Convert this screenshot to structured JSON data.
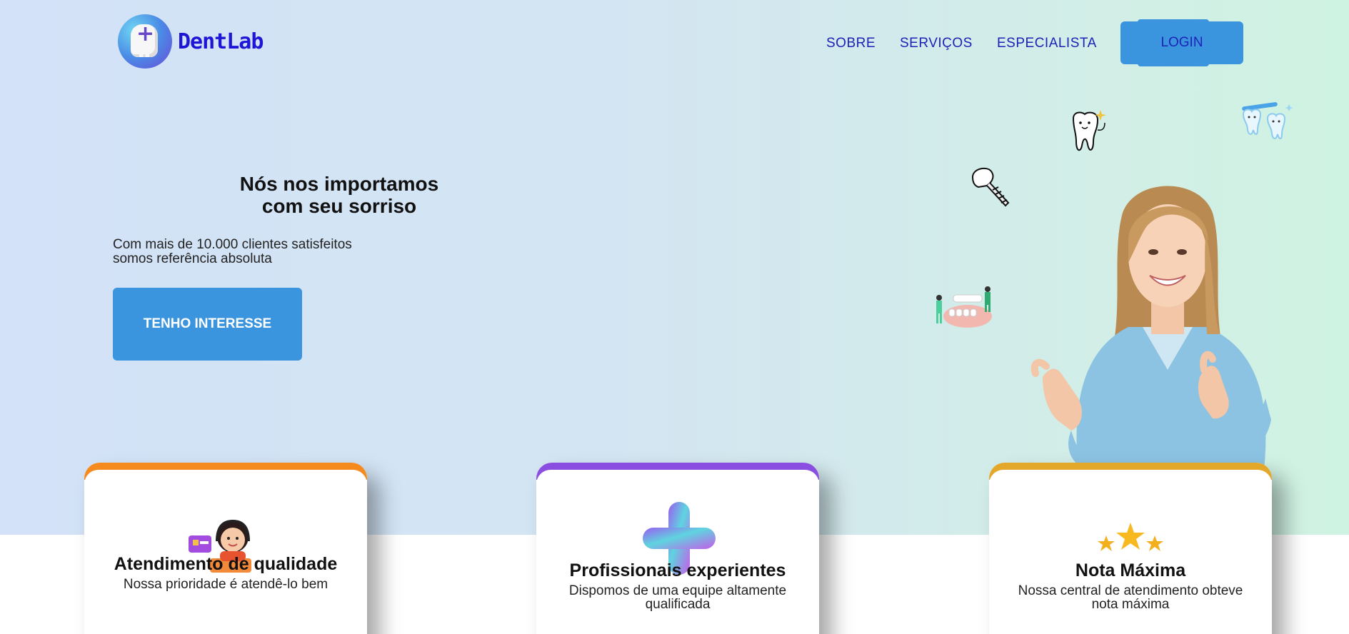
{
  "header": {
    "logo_text": "DentLab",
    "nav": [
      "SOBRE",
      "SERVIÇOS",
      "ESPECIALISTA"
    ],
    "login_label": "LOGIN"
  },
  "hero": {
    "title_line1": "Nós nos importamos",
    "title_line2": "com seu sorriso",
    "subtitle_line1": "Com mais de 10.000 clientes satisfeitos",
    "subtitle_line2": "somos referência absoluta",
    "cta_label": "TENHO INTERESSE"
  },
  "cards": [
    {
      "title": "Atendimento de qualidade",
      "description": "Nossa prioridade é atendê-lo bem",
      "accent": "#f58a1f",
      "icon": "support-agent-icon"
    },
    {
      "title": "Profissionais experientes",
      "description": "Dispomos de uma equipe altamente qualificada",
      "accent": "#8a4fe0",
      "icon": "plus-icon"
    },
    {
      "title": "Nota Máxima",
      "description": "Nossa central de atendimento obteve nota máxima",
      "accent": "#e3a82a",
      "icon": "stars-icon"
    }
  ],
  "colors": {
    "brand_blue": "#3a95de",
    "nav_text": "#1d22b8",
    "logo_text": "#1e16d6"
  }
}
